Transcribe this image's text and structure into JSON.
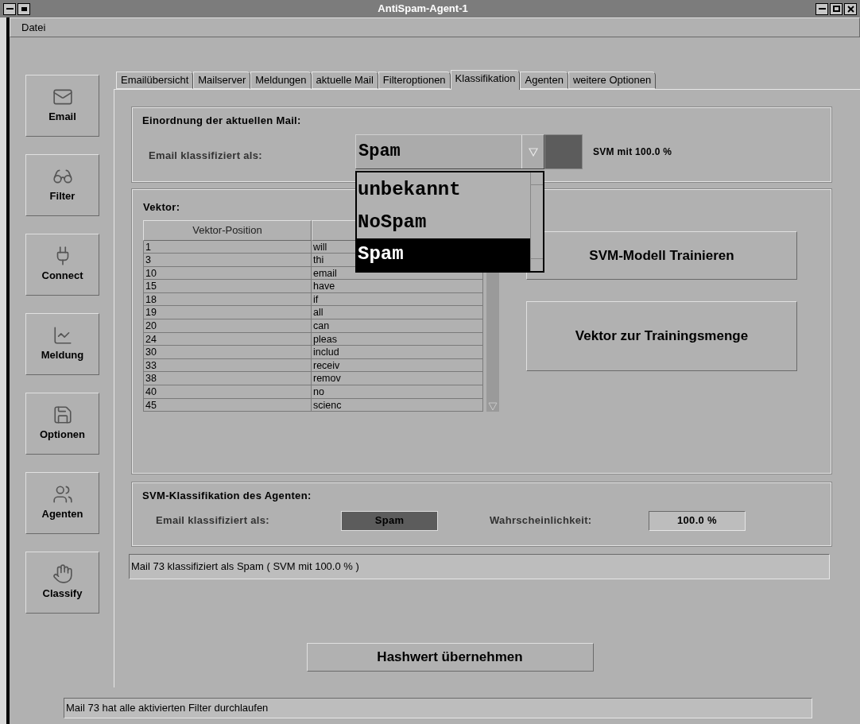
{
  "window": {
    "title": "AntiSpam-Agent-1"
  },
  "menu": [
    "Datei"
  ],
  "sidebar": [
    {
      "label": "Email",
      "kind": "envelope"
    },
    {
      "label": "Filter",
      "kind": "glasses"
    },
    {
      "label": "Connect",
      "kind": "plug"
    },
    {
      "label": "Meldung",
      "kind": "chart"
    },
    {
      "label": "Optionen",
      "kind": "disk"
    },
    {
      "label": "Agenten",
      "kind": "people"
    },
    {
      "label": "Classify",
      "kind": "hand"
    }
  ],
  "tabs": [
    {
      "label": "Emailübersicht",
      "selected": false
    },
    {
      "label": "Mailserver",
      "selected": false
    },
    {
      "label": "Meldungen",
      "selected": false
    },
    {
      "label": "aktuelle Mail",
      "selected": false
    },
    {
      "label": "Filteroptionen",
      "selected": false
    },
    {
      "label": "Klassifikation",
      "selected": true
    },
    {
      "label": "Agenten",
      "selected": false
    },
    {
      "label": "weitere Optionen",
      "selected": false
    }
  ],
  "classification": {
    "title": "Einordnung der aktuellen Mail:",
    "label": "Email klassifiziert als:",
    "value": "Spam",
    "expanded": true,
    "options": [
      {
        "label": "unbekannt",
        "selected": false
      },
      {
        "label": "NoSpam",
        "selected": false
      },
      {
        "label": "Spam",
        "selected": true
      }
    ],
    "result": "SVM mit 100.0 %"
  },
  "vector": {
    "title": "Vektor:",
    "columns": [
      "Vektor-Position"
    ],
    "rows": [
      [
        "1",
        "will"
      ],
      [
        "3",
        "thi"
      ],
      [
        "10",
        "email"
      ],
      [
        "15",
        "have"
      ],
      [
        "18",
        "if"
      ],
      [
        "19",
        "all"
      ],
      [
        "20",
        "can"
      ],
      [
        "24",
        "pleas"
      ],
      [
        "30",
        "includ"
      ],
      [
        "33",
        "receiv"
      ],
      [
        "38",
        "remov"
      ],
      [
        "40",
        "no"
      ],
      [
        "45",
        "scienc"
      ]
    ]
  },
  "buttons": [
    "SVM-Modell Trainieren",
    "Vektor zur Trainingsmenge"
  ],
  "agent": {
    "title": "SVM-Klassifikation des Agenten:",
    "label": "Email klassifiziert als:",
    "value": "Spam",
    "probability_label": "Wahrscheinlichkeit:",
    "probability": "100.0 %"
  },
  "message": "Mail 73 klassifiziert als Spam ( SVM mit 100.0 % )",
  "hash_button": "Hashwert übernehmen",
  "status_bar": "Mail 73 hat alle aktivierten Filter durchlaufen"
}
